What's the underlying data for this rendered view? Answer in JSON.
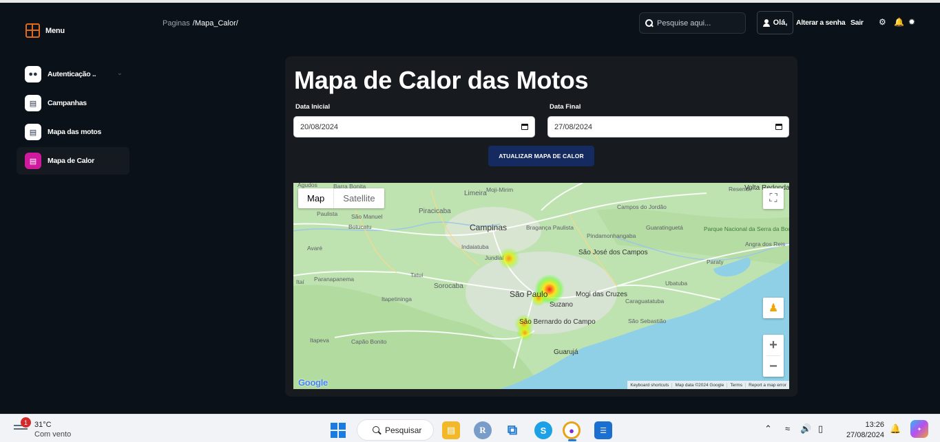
{
  "sidebar": {
    "brand": "Menu",
    "items": [
      {
        "label": "Autenticação ..",
        "icon": "users-icon",
        "active": false
      },
      {
        "label": "Campanhas",
        "icon": "store-icon",
        "active": false
      },
      {
        "label": "Mapa das motos",
        "icon": "store-icon",
        "active": false
      },
      {
        "label": "Mapa de Calor",
        "icon": "store-icon",
        "active": true
      }
    ]
  },
  "header": {
    "breadcrumb_root": "Paginas",
    "breadcrumb_current": "/Mapa_Calor/",
    "search_placeholder": "Pesquise aqui...",
    "greeting": "Olá,",
    "change_password": "Alterar a senha",
    "logout": "Sair"
  },
  "main": {
    "title": "Mapa de Calor das Motos",
    "start_label": "Data Inicial",
    "start_value": "20/08/2024",
    "end_label": "Data Final",
    "end_value": "27/08/2024",
    "update_button": "ATUALIZAR MAPA DE CALOR"
  },
  "map": {
    "tab_map": "Map",
    "tab_satellite": "Satellite",
    "zoom_in": "+",
    "zoom_out": "−",
    "logo": "Google",
    "attribution": [
      "Keyboard shortcuts",
      "Map data ©2024 Google",
      "Terms",
      "Report a map error"
    ],
    "places": [
      "Agudos",
      "Barra Bonita",
      "Limeira",
      "Moji-Mirim",
      "Resende",
      "Volta Redonda",
      "Paulista",
      "Piracicaba",
      "São Manuel",
      "Botucatu",
      "Campinas",
      "Bragança Paulista",
      "Campos do Jordão",
      "Guaratinguetá",
      "Parque Nacional da Serra da Bocaina",
      "Angra dos Reis",
      "Avaré",
      "Indaiatuba",
      "Pindamonhangaba",
      "São José dos Campos",
      "Paraty",
      "Jundiaí",
      "Tatuí",
      "Paranapanema",
      "Itaí",
      "Sorocaba",
      "Mogi das Cruzes",
      "Ubatuba",
      "São Paulo",
      "Suzano",
      "Caraguatatuba",
      "Itapetininga",
      "São Sebastião",
      "São Bernardo do Campo",
      "Itapeva",
      "Capão Bonito",
      "Guarujá"
    ],
    "heat_points": [
      {
        "place": "Jundiaí",
        "intensity": 0.6
      },
      {
        "place": "São Paulo",
        "intensity": 1.0
      },
      {
        "place": "São Bernardo do Campo",
        "intensity": 0.8
      }
    ]
  },
  "taskbar": {
    "weather_badge": "1",
    "temperature": "31°C",
    "weather_desc": "Com vento",
    "search_label": "Pesquisar",
    "time": "13:26",
    "date": "27/08/2024"
  }
}
